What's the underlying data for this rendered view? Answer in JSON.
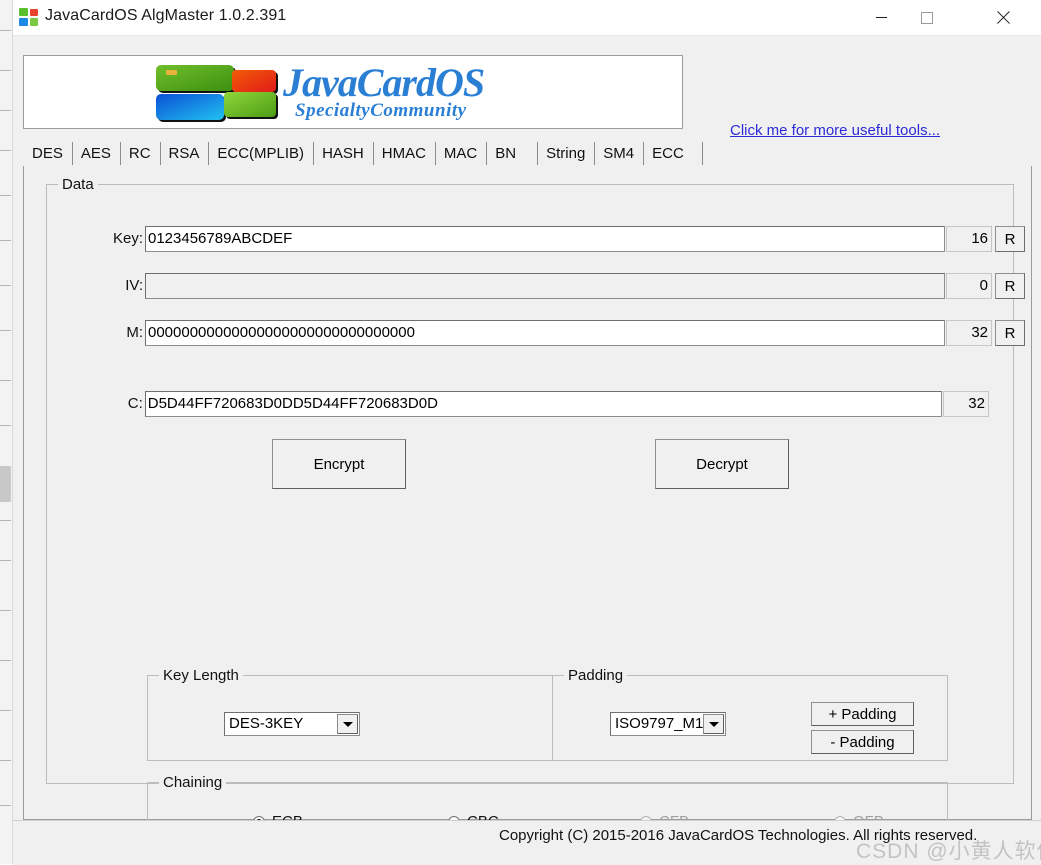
{
  "window": {
    "title": "JavaCardOS AlgMaster 1.0.2.391",
    "icon": "app-logo-icon",
    "controls": {
      "minimize": "minimize-icon",
      "maximize": "maximize-icon",
      "close": "close-icon"
    }
  },
  "banner": {
    "logo_main": "JavaCardOS",
    "logo_sub": "SpecialtyCommunity",
    "tools_link": "Click me for more useful tools..."
  },
  "tabs": [
    {
      "label": "DES",
      "selected": true
    },
    {
      "label": "AES",
      "selected": false
    },
    {
      "label": "RC",
      "selected": false
    },
    {
      "label": "RSA",
      "selected": false
    },
    {
      "label": "ECC(MPLIB)",
      "selected": false
    },
    {
      "label": "HASH",
      "selected": false
    },
    {
      "label": "HMAC",
      "selected": false
    },
    {
      "label": "MAC",
      "selected": false
    },
    {
      "label": "BN",
      "selected": false
    },
    {
      "label": "String",
      "selected": false
    },
    {
      "label": "SM4",
      "selected": false
    },
    {
      "label": "ECC",
      "selected": false
    }
  ],
  "data_group": {
    "title": "Data",
    "fields": [
      {
        "label": "Key:",
        "value": "0123456789ABCDEF",
        "placeholder": "",
        "length": "16",
        "random_button": "R",
        "disabled": false
      },
      {
        "label": "IV:",
        "value": "",
        "placeholder": "",
        "length": "0",
        "random_button": "R",
        "disabled": true
      },
      {
        "label": "M:",
        "value": "00000000000000000000000000000000",
        "placeholder": "",
        "length": "32",
        "random_button": "R",
        "disabled": false
      },
      {
        "label": "C:",
        "value": "D5D44FF720683D0DD5D44FF720683D0D",
        "placeholder": "",
        "length": "32",
        "random_button": null,
        "disabled": false
      }
    ],
    "encrypt_button": "Encrypt",
    "decrypt_button": "Decrypt"
  },
  "key_length_group": {
    "title": "Key Length",
    "selected": "DES-3KEY",
    "options": [
      "DES-3KEY"
    ],
    "arrow_icon": "chevron-down-icon"
  },
  "padding_group": {
    "title": "Padding",
    "selected": "ISO9797_M1",
    "options": [
      "ISO9797_M1"
    ],
    "arrow_icon": "chevron-down-icon",
    "add_padding_button": "+ Padding",
    "remove_padding_button": "- Padding"
  },
  "chaining_group": {
    "title": "Chaining",
    "options": [
      {
        "label": "ECB",
        "selected": true,
        "disabled": false
      },
      {
        "label": "CBC",
        "selected": false,
        "disabled": false
      },
      {
        "label": "CFB",
        "selected": false,
        "disabled": true
      },
      {
        "label": "OFB",
        "selected": false,
        "disabled": true
      }
    ]
  },
  "footer": {
    "copyright": "Copyright (C) 2015-2016 JavaCardOS Technologies. All rights reserved.",
    "watermark": "CSDN @小黄人软件"
  },
  "colors": {
    "link": "#2b2bd8",
    "window_bg": "#f0f0f0",
    "logo_blue": "#2a7fd4",
    "disabled_text": "#a0a0a0"
  }
}
